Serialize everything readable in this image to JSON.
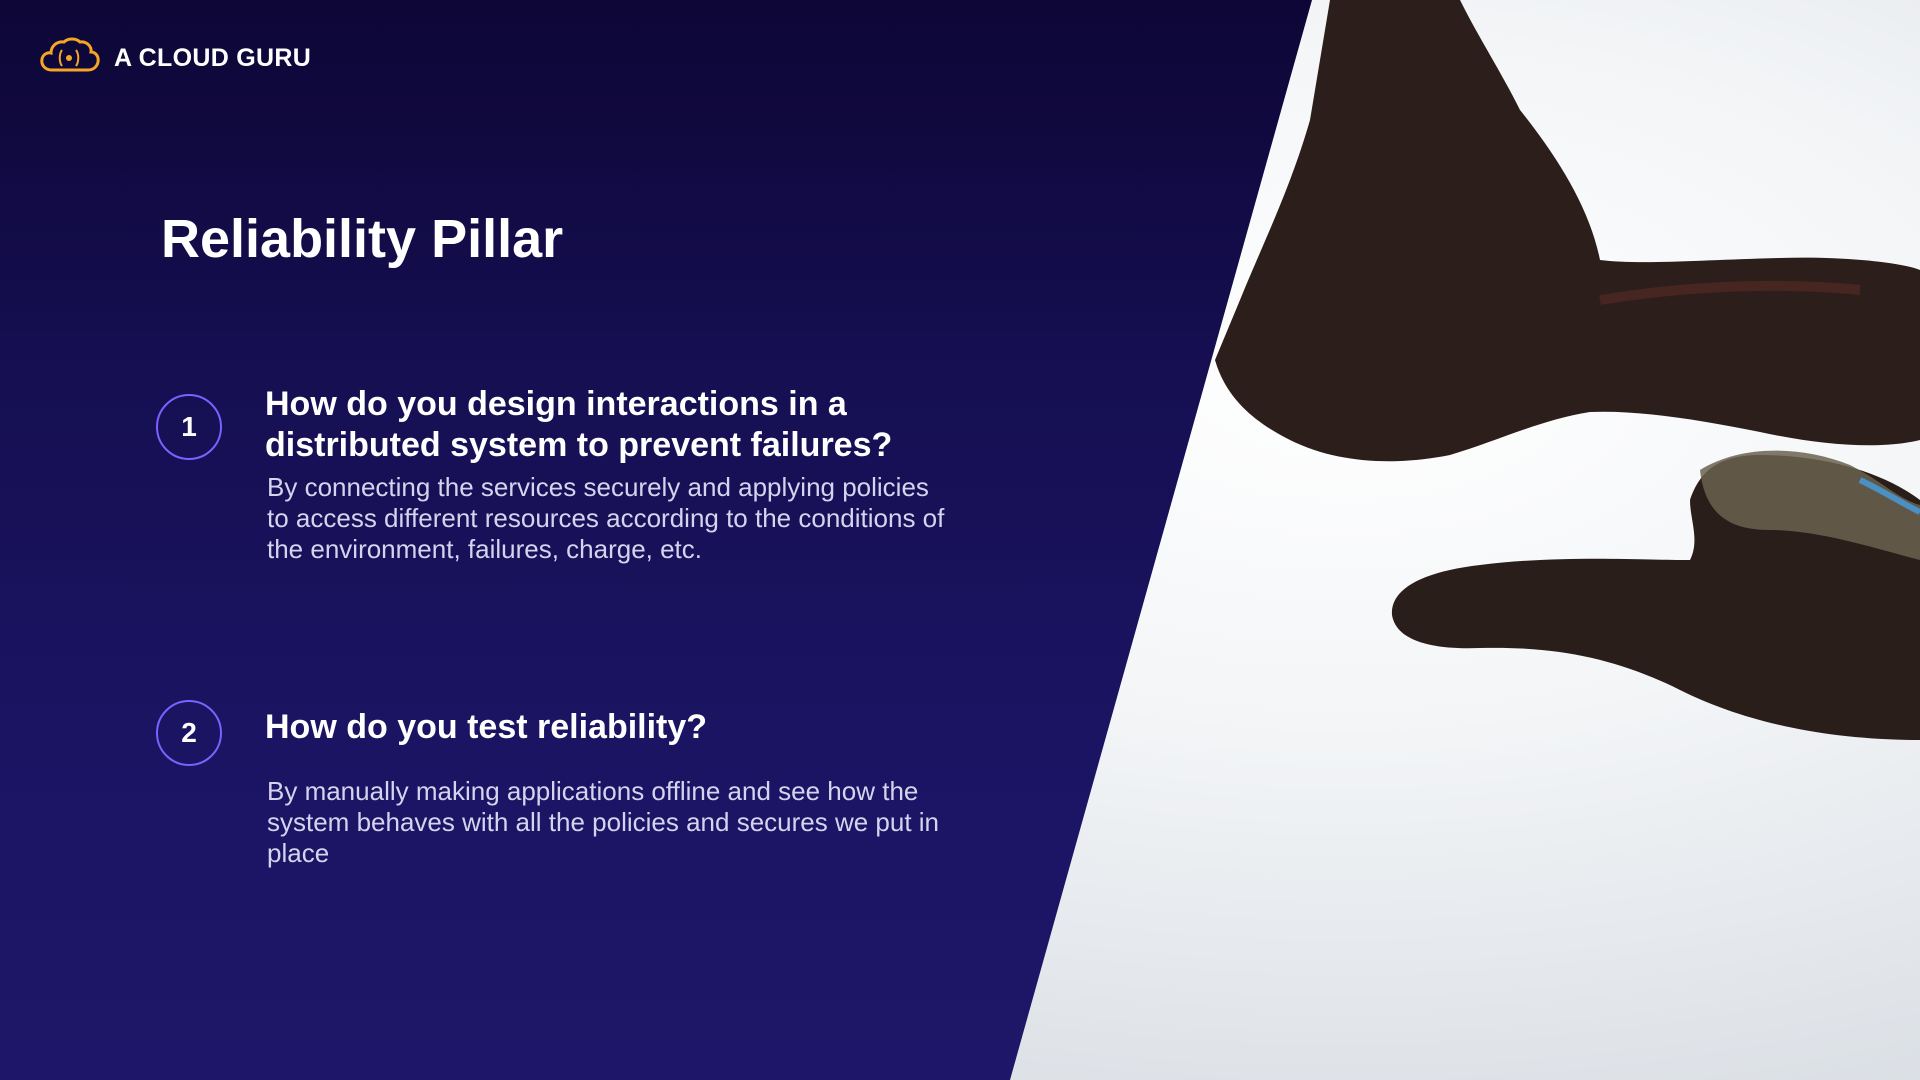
{
  "brand": {
    "name": "A CLOUD GURU",
    "logo_icon": "cloud-logo-icon",
    "logo_color": "#f5a623"
  },
  "slide": {
    "title": "Reliability Pillar",
    "items": [
      {
        "number": "1",
        "question": "How do you design interactions in a distributed system to prevent failures?",
        "answer": "By connecting the services securely and applying policies to access different resources according to the conditions of the environment, failures, charge, etc."
      },
      {
        "number": "2",
        "question": "How do you test reliability?",
        "answer": "By manually making applications offline and see how the system behaves with all the policies and secures we put in place"
      }
    ]
  },
  "colors": {
    "panel": "#160f52",
    "accent": "#7b61ff",
    "text": "#ffffff"
  },
  "image": {
    "subject": "hands-reaching-photo"
  }
}
